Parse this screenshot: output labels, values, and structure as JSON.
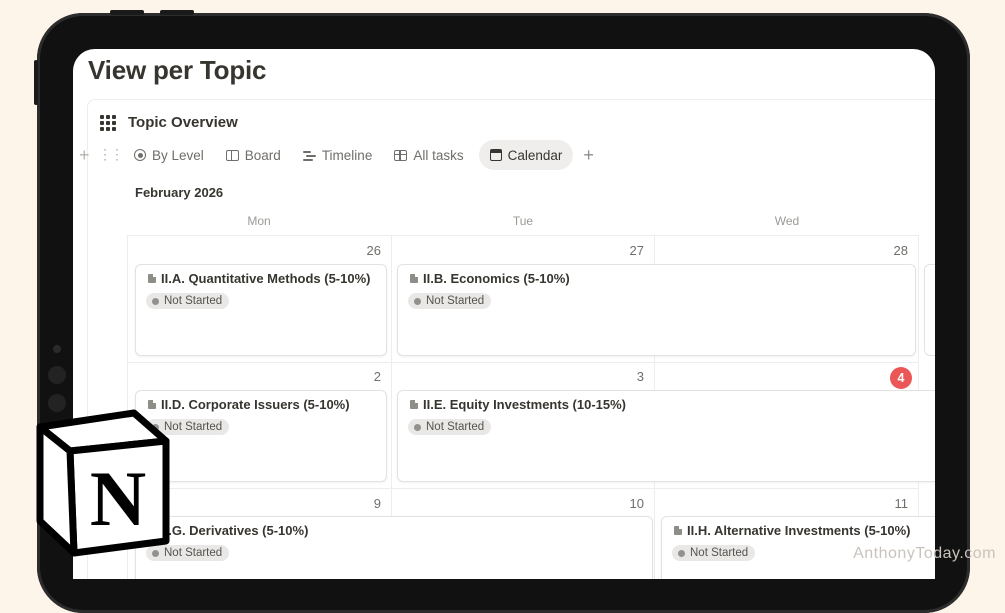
{
  "page": {
    "title": "View per Topic"
  },
  "database": {
    "title": "Topic Overview"
  },
  "tabs": [
    {
      "label": "By Level",
      "icon": "target-icon"
    },
    {
      "label": "Board",
      "icon": "board-icon"
    },
    {
      "label": "Timeline",
      "icon": "timeline-icon"
    },
    {
      "label": "All tasks",
      "icon": "table-icon"
    },
    {
      "label": "Calendar",
      "icon": "calendar-icon",
      "active": true
    }
  ],
  "calendar": {
    "month": "February 2026",
    "weekdays": [
      "Mon",
      "Tue",
      "Wed"
    ],
    "days": [
      "26",
      "27",
      "28",
      "2",
      "3",
      "4",
      "9",
      "10",
      "11"
    ],
    "today": "4",
    "today_color": "#eb5757"
  },
  "events": [
    {
      "title": "II.A. Quantitative Methods (5-10%)",
      "status": "Not Started"
    },
    {
      "title": "II.B. Economics (5-10%)",
      "status": "Not Started"
    },
    {
      "title": "II.D. Corporate Issuers (5-10%)",
      "status": "Not Started"
    },
    {
      "title": "II.E. Equity Investments (10-15%)",
      "status": "Not Started"
    },
    {
      "title": "II.G. Derivatives (5-10%)",
      "status": "Not Started"
    },
    {
      "title": "II.H. Alternative Investments (5-10%)",
      "status": "Not Started"
    }
  ],
  "logo": {
    "name": "notion-logo",
    "text": "N"
  },
  "watermark": "AnthonyToday.com",
  "colors": {
    "background": "#fdf4ea",
    "status_badge": "#e9e8e6",
    "accent": "#eb5757"
  }
}
